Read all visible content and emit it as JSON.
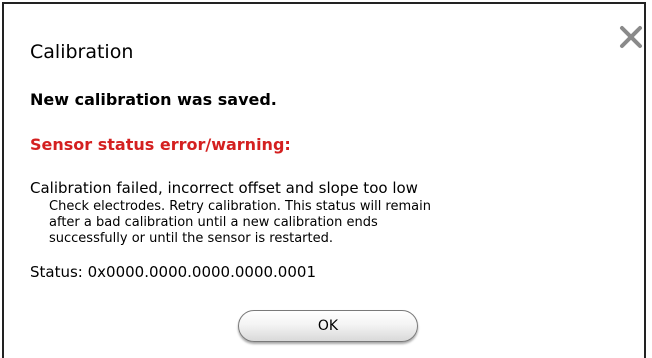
{
  "dialog": {
    "title": "Calibration",
    "saved_message": "New calibration was saved.",
    "error_heading": "Sensor status error/warning:",
    "error_title": "Calibration failed, incorrect offset and slope too low",
    "error_detail_lines": [
      "Check electrodes. Retry calibration. This status will remain",
      "after a bad calibration until a new calibration ends",
      "successfully or until the sensor is restarted."
    ],
    "status_text": "Status: 0x0000.0000.0000.0000.0001",
    "ok_label": "OK",
    "close_icon": "close-icon"
  },
  "colors": {
    "error": "#d42020",
    "close_icon": "#8a8a8a",
    "border": "#222222"
  }
}
